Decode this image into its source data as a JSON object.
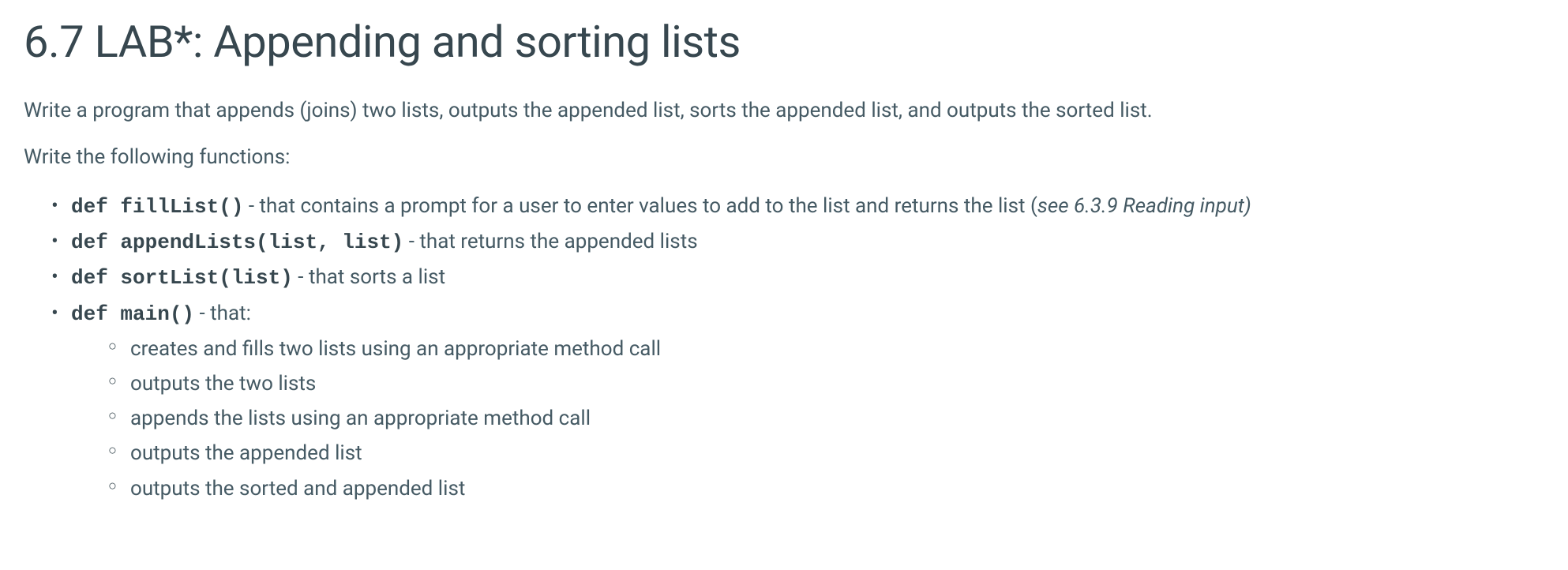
{
  "title": "6.7 LAB*: Appending and sorting lists",
  "intro": "Write a program that appends (joins) two lists, outputs the appended list, sorts the appended list, and outputs the sorted list.",
  "subintro": "Write the following functions:",
  "functions": [
    {
      "code": "def fillList()",
      "desc_prefix": " - that contains a prompt for a user to enter values to add to the list and returns the list (",
      "desc_italic": "see 6.3.9 Reading input)",
      "desc_suffix": ""
    },
    {
      "code": "def appendLists(list, list)",
      "desc_prefix": " - that returns the appended lists",
      "desc_italic": "",
      "desc_suffix": ""
    },
    {
      "code": "def sortList(list)",
      "desc_prefix": " - that sorts a list",
      "desc_italic": "",
      "desc_suffix": ""
    },
    {
      "code": "def main()",
      "desc_prefix": " - that:",
      "desc_italic": "",
      "desc_suffix": ""
    }
  ],
  "main_steps": [
    "creates and fills two lists using an appropriate method call",
    "outputs the two lists",
    "appends the lists using an appropriate method call",
    "outputs the appended list",
    "outputs the sorted and appended list"
  ]
}
